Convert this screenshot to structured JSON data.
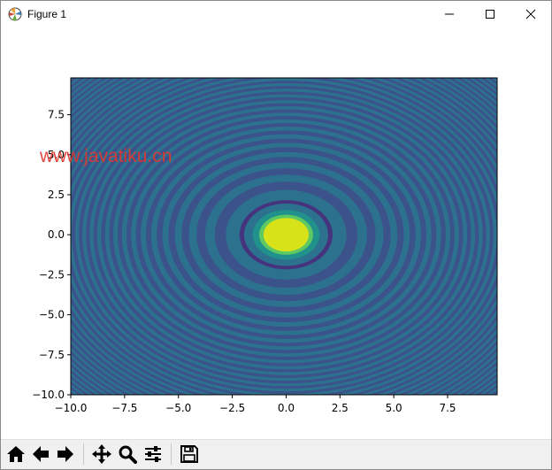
{
  "window": {
    "title": "Figure 1",
    "controls": [
      "minimize",
      "maximize",
      "close"
    ]
  },
  "watermark": "www.javatiku.cn",
  "toolbar": {
    "buttons": [
      {
        "name": "home-button",
        "icon": "home-icon"
      },
      {
        "name": "back-button",
        "icon": "arrow-left-icon"
      },
      {
        "name": "forward-button",
        "icon": "arrow-right-icon"
      },
      {
        "name": "pan-button",
        "icon": "move-icon"
      },
      {
        "name": "zoom-button",
        "icon": "magnifier-icon"
      },
      {
        "name": "configure-subplots-button",
        "icon": "sliders-icon"
      },
      {
        "name": "save-button",
        "icon": "floppy-disk-icon"
      }
    ]
  },
  "colors": {
    "background": "#3b528b",
    "ring_dark": "#46337e",
    "ring_teal": "#2c728e",
    "ring_green": "#21918c",
    "inner_green": "#5ec962",
    "center_yellow": "#d8e219"
  },
  "chart_data": {
    "type": "contour",
    "function": "sin(x^2 + y^2) / (x^2 + y^2)",
    "filled": true,
    "colormap": "viridis",
    "xlim": [
      -10,
      9.8
    ],
    "ylim": [
      -10,
      9.8
    ],
    "xticks": [
      -10.0,
      -7.5,
      -5.0,
      -2.5,
      0.0,
      2.5,
      5.0,
      7.5
    ],
    "yticks": [
      -10.0,
      -7.5,
      -5.0,
      -2.5,
      0.0,
      2.5,
      5.0,
      7.5
    ],
    "xtick_labels": [
      "−10.0",
      "−7.5",
      "−5.0",
      "−2.5",
      "0.0",
      "2.5",
      "5.0",
      "7.5"
    ],
    "ytick_labels": [
      "−10.0",
      "−7.5",
      "−5.0",
      "−2.5",
      "0.0",
      "2.5",
      "5.0",
      "7.5"
    ],
    "grid": false,
    "legend": null
  }
}
